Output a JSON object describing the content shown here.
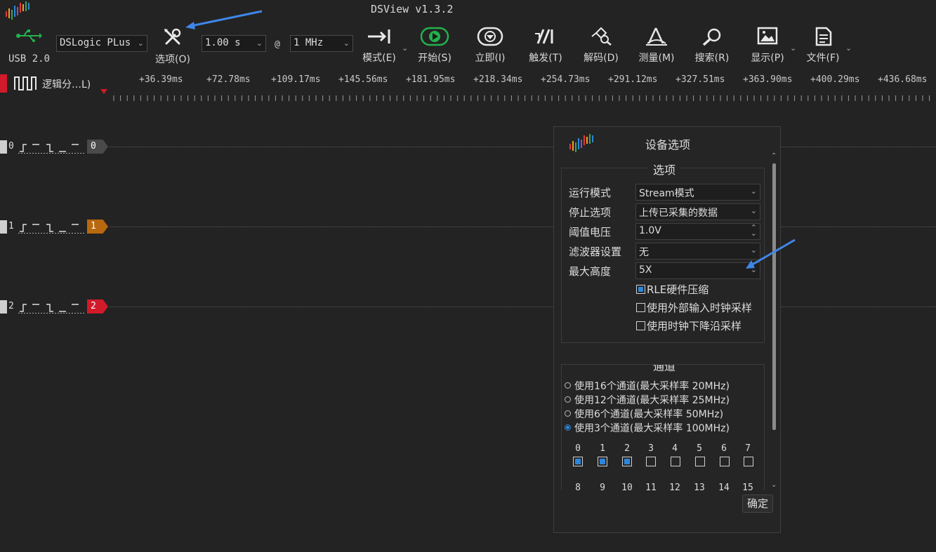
{
  "window": {
    "title": "DSView v1.3.2"
  },
  "colors": {
    "accent": "#2f86d8",
    "start_green": "#23b14d",
    "red": "#d11a2a",
    "ch0": "#4a4a4a",
    "ch1": "#b8680f",
    "ch2": "#d11a2a"
  },
  "toolbar": {
    "usb_label": "USB 2.0",
    "device": "DSLogic PLus",
    "options_label": "选项(O)",
    "duration": "1.00 s",
    "at": "@",
    "samplerate": "1 MHz",
    "mode_label": "模式(E)",
    "start_label": "开始(S)",
    "instant_label": "立即(I)",
    "trigger_label": "触发(T)",
    "decode_label": "解码(D)",
    "measure_label": "测量(M)",
    "search_label": "搜索(R)",
    "display_label": "显示(P)",
    "file_label": "文件(F)"
  },
  "ruler": {
    "group_name": "逻辑分…L)",
    "ticks": [
      "+36.39ms",
      "+72.78ms",
      "+109.17ms",
      "+145.56ms",
      "+181.95ms",
      "+218.34ms",
      "+254.73ms",
      "+291.12ms",
      "+327.51ms",
      "+363.90ms",
      "+400.29ms",
      "+436.68ms"
    ]
  },
  "channels": [
    {
      "index": "0",
      "tag": "0"
    },
    {
      "index": "1",
      "tag": "1"
    },
    {
      "index": "2",
      "tag": "2"
    }
  ],
  "dialog": {
    "title": "设备选项",
    "options_group": "选项",
    "rows": [
      {
        "label": "运行模式",
        "value": "Stream模式"
      },
      {
        "label": "停止选项",
        "value": "上传已采集的数据"
      },
      {
        "label": "阈值电压",
        "value": "1.0V"
      },
      {
        "label": "滤波器设置",
        "value": "无"
      },
      {
        "label": "最大高度",
        "value": "5X"
      }
    ],
    "checks": [
      {
        "label": "RLE硬件压缩",
        "checked": true
      },
      {
        "label": "使用外部输入时钟采样",
        "checked": false
      },
      {
        "label": "使用时钟下降沿采样",
        "checked": false
      }
    ],
    "channels_group": "通道",
    "radios": [
      {
        "label": "使用16个通道(最大采样率 20MHz)",
        "selected": false
      },
      {
        "label": "使用12个通道(最大采样率 25MHz)",
        "selected": false
      },
      {
        "label": "使用6个通道(最大采样率 50MHz)",
        "selected": false
      },
      {
        "label": "使用3个通道(最大采样率 100MHz)",
        "selected": true
      }
    ],
    "channel_numbers_row1": [
      "0",
      "1",
      "2",
      "3",
      "4",
      "5",
      "6",
      "7"
    ],
    "channel_checked_row1": [
      true,
      true,
      true,
      false,
      false,
      false,
      false,
      false
    ],
    "channel_numbers_row2": [
      "8",
      "9",
      "10",
      "11",
      "12",
      "13",
      "14",
      "15"
    ],
    "ok": "确定"
  }
}
